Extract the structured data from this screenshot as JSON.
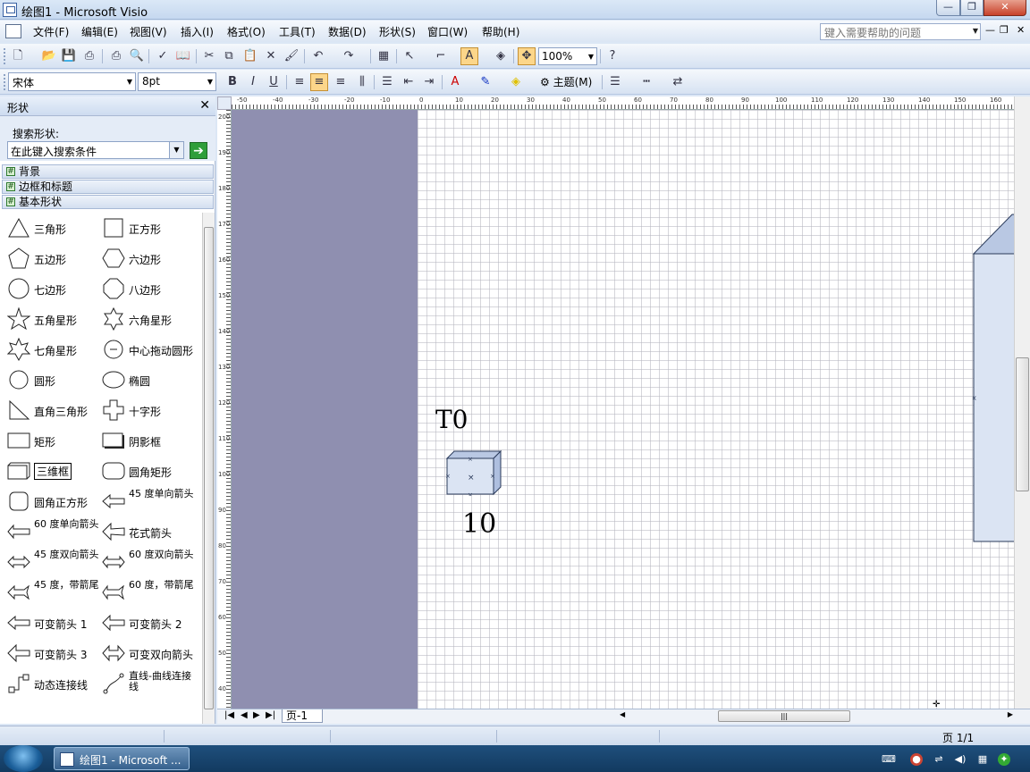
{
  "window": {
    "title": "绘图1 - Microsoft Visio",
    "minimize": "—",
    "maximize": "❐",
    "close": "✕"
  },
  "menubar": {
    "items": [
      "文件(F)",
      "编辑(E)",
      "视图(V)",
      "插入(I)",
      "格式(O)",
      "工具(T)",
      "数据(D)",
      "形状(S)",
      "窗口(W)",
      "帮助(H)"
    ],
    "help_placeholder": "键入需要帮助的问题"
  },
  "toolbar": {
    "zoom": "100%",
    "font_name": "宋体",
    "font_size": "8pt",
    "theme_label": "主题(M)"
  },
  "shapes_panel": {
    "title": "形状",
    "search_label": "搜索形状:",
    "search_placeholder": "在此键入搜索条件",
    "stencils": [
      "背景",
      "边框和标题",
      "基本形状"
    ],
    "items": [
      {
        "label": "三角形",
        "icon": "triangle-icon"
      },
      {
        "label": "正方形",
        "icon": "square-icon"
      },
      {
        "label": "五边形",
        "icon": "pentagon-icon"
      },
      {
        "label": "六边形",
        "icon": "hexagon-icon"
      },
      {
        "label": "七边形",
        "icon": "heptagon-icon"
      },
      {
        "label": "八边形",
        "icon": "octagon-icon"
      },
      {
        "label": "五角星形",
        "icon": "star5-icon"
      },
      {
        "label": "六角星形",
        "icon": "star6-icon"
      },
      {
        "label": "七角星形",
        "icon": "star7-icon"
      },
      {
        "label": "中心拖动圆形",
        "icon": "center-circle-icon"
      },
      {
        "label": "圆形",
        "icon": "circle-icon"
      },
      {
        "label": "椭圆",
        "icon": "ellipse-icon"
      },
      {
        "label": "直角三角形",
        "icon": "right-triangle-icon"
      },
      {
        "label": "十字形",
        "icon": "cross-icon"
      },
      {
        "label": "矩形",
        "icon": "rectangle-icon"
      },
      {
        "label": "阴影框",
        "icon": "shadow-box-icon"
      },
      {
        "label": "三维框",
        "icon": "box3d-icon"
      },
      {
        "label": "圆角矩形",
        "icon": "rounded-rect-icon"
      },
      {
        "label": "圆角正方形",
        "icon": "rounded-square-icon"
      },
      {
        "label": "45 度单向箭头",
        "icon": "arrow45-icon"
      },
      {
        "label": "60 度单向箭头",
        "icon": "arrow60-icon"
      },
      {
        "label": "花式箭头",
        "icon": "fancy-arrow-icon"
      },
      {
        "label": "45 度双向箭头",
        "icon": "double-arrow45-icon"
      },
      {
        "label": "60 度双向箭头",
        "icon": "double-arrow60-icon"
      },
      {
        "label": "45 度，带箭尾",
        "icon": "tail-arrow45-icon"
      },
      {
        "label": "60 度，带箭尾",
        "icon": "tail-arrow60-icon"
      },
      {
        "label": "可变箭头 1",
        "icon": "flex-arrow1-icon"
      },
      {
        "label": "可变箭头 2",
        "icon": "flex-arrow2-icon"
      },
      {
        "label": "可变箭头 3",
        "icon": "flex-arrow3-icon"
      },
      {
        "label": "可变双向箭头",
        "icon": "flex-double-arrow-icon"
      },
      {
        "label": "动态连接线",
        "icon": "dynamic-connector-icon"
      },
      {
        "label": "直线-曲线连接线",
        "icon": "line-curve-connector-icon"
      }
    ]
  },
  "canvas": {
    "shape_label_top": "T0",
    "shape_label_bottom": "10",
    "page_tab": "页-1"
  },
  "rulers": {
    "top": [
      "-50",
      "-40",
      "-30",
      "-20",
      "-10",
      "0",
      "10",
      "20",
      "30",
      "40",
      "50",
      "60",
      "70",
      "80",
      "90",
      "100",
      "110",
      "120",
      "130",
      "140",
      "150",
      "160"
    ],
    "left": [
      "200",
      "190",
      "180",
      "170",
      "160",
      "150",
      "140",
      "130",
      "120",
      "110",
      "100",
      "90",
      "80",
      "70",
      "60",
      "50",
      "40"
    ]
  },
  "statusbar": {
    "page_info": "页 1/1"
  },
  "taskbar": {
    "task_label": "绘图1 - Microsoft ..."
  },
  "colors": {
    "canvas_bg": "#8f8fb0",
    "shape_fill": "#dbe4f3",
    "shape_top": "#b9c8e3",
    "accent": "#fcd68a"
  }
}
